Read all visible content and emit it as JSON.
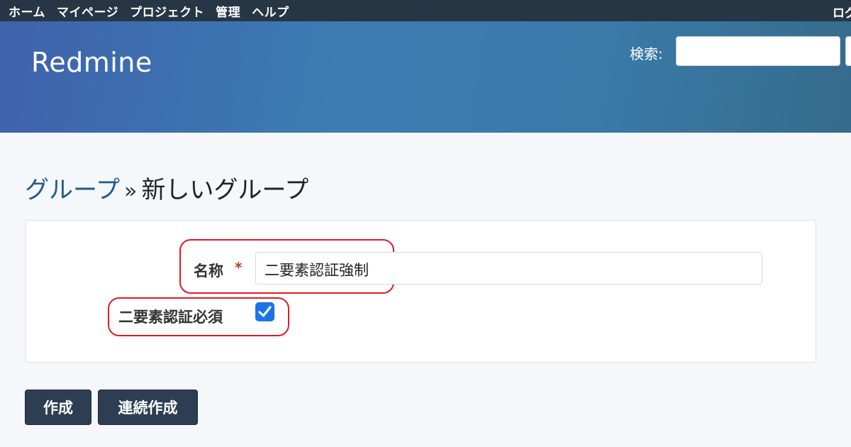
{
  "top_menu": {
    "items": [
      {
        "label": "ホーム"
      },
      {
        "label": "マイページ"
      },
      {
        "label": "プロジェクト"
      },
      {
        "label": "管理"
      },
      {
        "label": "ヘルプ"
      }
    ],
    "login_label": "ログ"
  },
  "header": {
    "site_title": "Redmine",
    "search_label": "検索:",
    "search_value": ""
  },
  "breadcrumb": {
    "parent": "グループ",
    "separator": "»",
    "current": "新しいグループ"
  },
  "form": {
    "name_label": "名称",
    "required_mark": "*",
    "name_value": "二要素認証強制",
    "twofa_label": "二要素認証必須",
    "twofa_checked": true
  },
  "buttons": {
    "create": "作成",
    "create_continue": "連続作成"
  },
  "colors": {
    "top_menu_bg": "#263645",
    "header_gradient_start": "#3e62ad",
    "header_gradient_end": "#356b8c",
    "link": "#1f5c8a",
    "highlight": "#e01b24",
    "checkbox": "#1a73e8",
    "button_bg": "#2d3e52"
  }
}
